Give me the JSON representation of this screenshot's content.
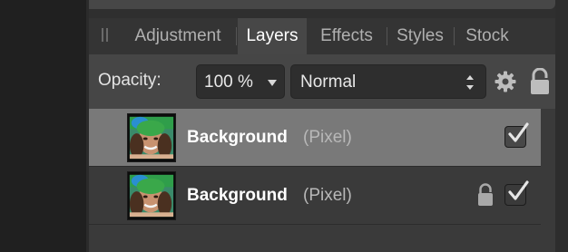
{
  "tabs": [
    {
      "label": "Adjustment",
      "active": false
    },
    {
      "label": "Layers",
      "active": true
    },
    {
      "label": "Effects",
      "active": false
    },
    {
      "label": "Styles",
      "active": false
    },
    {
      "label": "Stock",
      "active": false
    }
  ],
  "options": {
    "opacity_label": "Opacity:",
    "opacity_value": "100 %",
    "blend_mode": "Normal",
    "settings_icon": "gear-icon",
    "lock_icon": "lock-icon"
  },
  "layers": [
    {
      "name": "Background",
      "type": "(Pixel)",
      "selected": true,
      "locked": false,
      "visible": true
    },
    {
      "name": "Background",
      "type": "(Pixel)",
      "selected": false,
      "locked": true,
      "visible": true
    }
  ],
  "colors": {
    "panel_bg": "#3a3a3a",
    "active_tab_bg": "#474747",
    "selected_row_bg": "#797979",
    "text_primary": "#ffffff",
    "text_secondary": "#b0b0b0"
  }
}
